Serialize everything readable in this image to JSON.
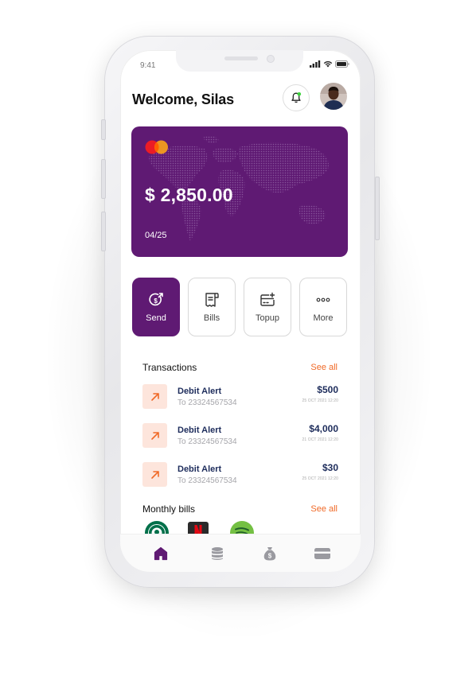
{
  "status_bar": {
    "time": "9:41"
  },
  "header": {
    "welcome": "Welcome, Silas"
  },
  "card": {
    "balance": "$ 2,850.00",
    "expiry": "04/25"
  },
  "actions": [
    {
      "label": "Send",
      "icon": "send-money-icon",
      "active": true
    },
    {
      "label": "Bills",
      "icon": "receipt-icon",
      "active": false
    },
    {
      "label": "Topup",
      "icon": "topup-card-icon",
      "active": false
    },
    {
      "label": "More",
      "icon": "more-dots-icon",
      "active": false
    }
  ],
  "transactions": {
    "title": "Transactions",
    "see_all": "See all",
    "items": [
      {
        "title": "Debit Alert",
        "subtitle": "To 23324567534",
        "amount": "$500",
        "date": "25 OCT 2021 12:20"
      },
      {
        "title": "Debit Alert",
        "subtitle": "To 23324567534",
        "amount": "$4,000",
        "date": "21 OCT 2021 12:20"
      },
      {
        "title": "Debit Alert",
        "subtitle": "To 23324567534",
        "amount": "$30",
        "date": "25 OCT 2021 12:20"
      }
    ]
  },
  "monthly_bills": {
    "title": "Monthly bills",
    "see_all": "See all",
    "items": [
      {
        "icon": "starbucks-logo"
      },
      {
        "icon": "netflix-logo"
      },
      {
        "icon": "spotify-logo"
      }
    ]
  },
  "bottom_nav": [
    {
      "icon": "home-icon",
      "active": true
    },
    {
      "icon": "database-icon",
      "active": false
    },
    {
      "icon": "money-bag-icon",
      "active": false
    },
    {
      "icon": "wallet-card-icon",
      "active": false
    }
  ],
  "colors": {
    "brand": "#5f1a73",
    "accent": "#f06a28",
    "amount_text": "#1e2d5c"
  }
}
